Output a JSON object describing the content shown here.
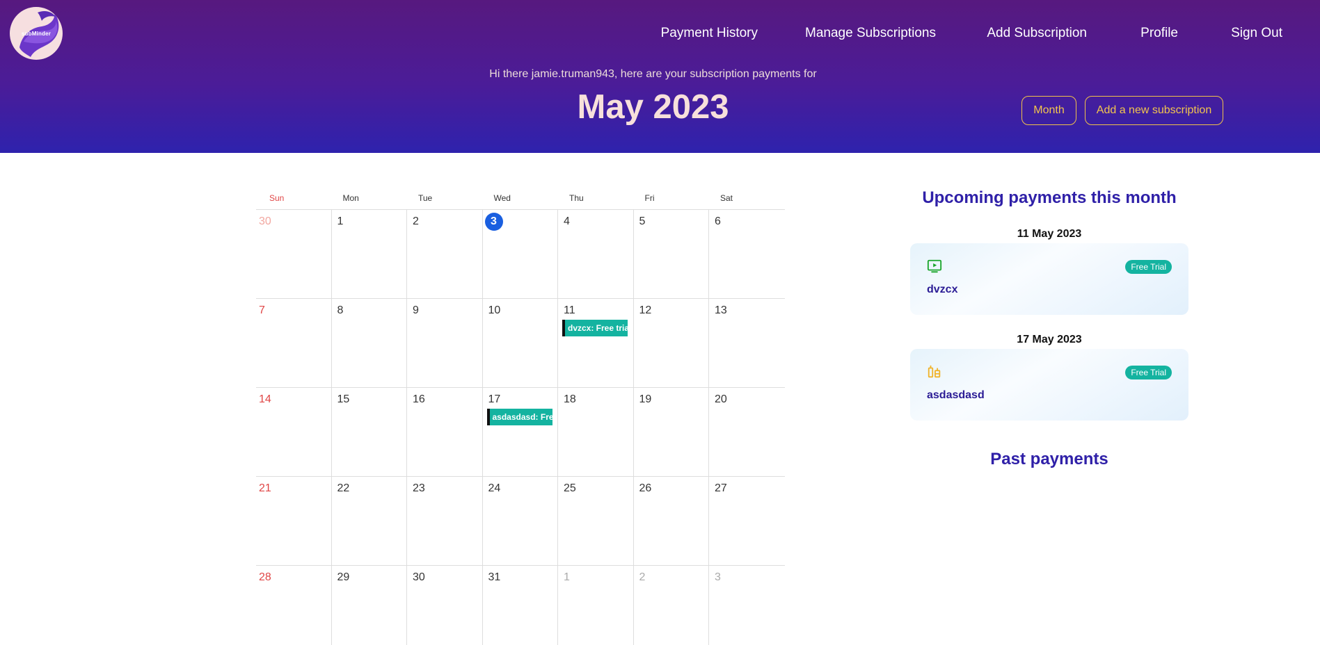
{
  "app": {
    "logo_text": "subMinder"
  },
  "nav": {
    "payment_history": "Payment History",
    "manage_subscriptions": "Manage Subscriptions",
    "add_subscription": "Add Subscription",
    "profile": "Profile",
    "sign_out": "Sign Out"
  },
  "header": {
    "greeting": "Hi there jamie.truman943, here are your subscription payments for",
    "month_title": "May 2023",
    "view_button": "Month",
    "add_button": "Add a new subscription"
  },
  "colors": {
    "header_top": "#57197f",
    "header_bottom": "#2e22ad",
    "accent_yellow": "#f3c54d",
    "event_teal": "#14b3a0",
    "today_blue": "#1a5fe0",
    "sunday_red": "#e04646",
    "title_purple": "#2f20a8"
  },
  "calendar": {
    "weekdays": [
      "Sun",
      "Mon",
      "Tue",
      "Wed",
      "Thu",
      "Fri",
      "Sat"
    ],
    "weeks": [
      [
        {
          "d": "30",
          "muted": true
        },
        {
          "d": "1"
        },
        {
          "d": "2"
        },
        {
          "d": "3",
          "today": true
        },
        {
          "d": "4"
        },
        {
          "d": "5"
        },
        {
          "d": "6"
        }
      ],
      [
        {
          "d": "7"
        },
        {
          "d": "8"
        },
        {
          "d": "9"
        },
        {
          "d": "10"
        },
        {
          "d": "11",
          "event": "dvzcx: Free trial"
        },
        {
          "d": "12"
        },
        {
          "d": "13"
        }
      ],
      [
        {
          "d": "14"
        },
        {
          "d": "15"
        },
        {
          "d": "16"
        },
        {
          "d": "17",
          "event": "asdasdasd: Free trial"
        },
        {
          "d": "18"
        },
        {
          "d": "19"
        },
        {
          "d": "20"
        }
      ],
      [
        {
          "d": "21"
        },
        {
          "d": "22"
        },
        {
          "d": "23"
        },
        {
          "d": "24"
        },
        {
          "d": "25"
        },
        {
          "d": "26"
        },
        {
          "d": "27"
        }
      ],
      [
        {
          "d": "28"
        },
        {
          "d": "29"
        },
        {
          "d": "30"
        },
        {
          "d": "31"
        },
        {
          "d": "1",
          "muted": true
        },
        {
          "d": "2",
          "muted": true
        },
        {
          "d": "3",
          "muted": true
        }
      ]
    ]
  },
  "upcoming": {
    "title": "Upcoming payments this month",
    "items": [
      {
        "date": "11 May 2023",
        "name": "dvzcx",
        "badge": "Free Trial",
        "icon": "tv-play-icon",
        "icon_color": "#1aa52a"
      },
      {
        "date": "17 May 2023",
        "name": "asdasdasd",
        "badge": "Free Trial",
        "icon": "fuel-pump-icon",
        "icon_color": "#f0b32a"
      }
    ]
  },
  "past": {
    "title": "Past payments"
  }
}
